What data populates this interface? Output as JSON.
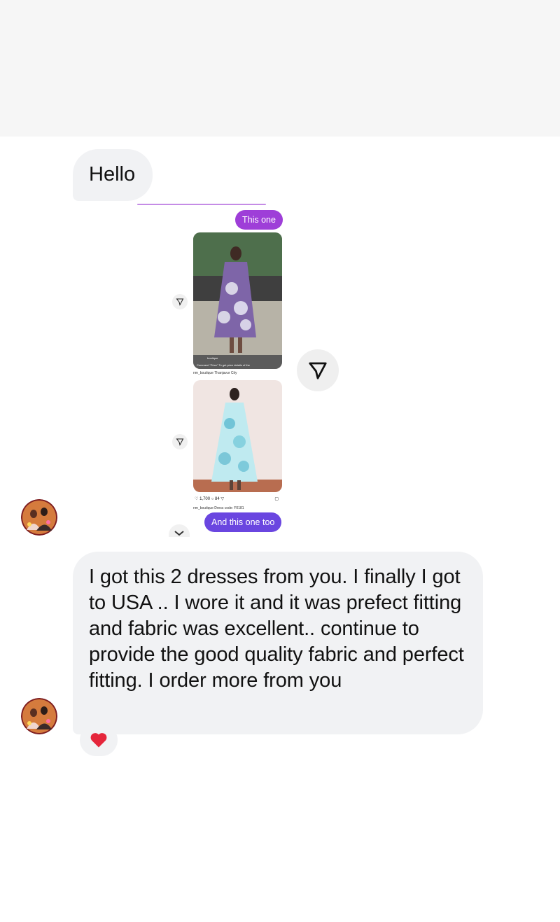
{
  "messages": {
    "greeting": "Hello",
    "reply_chip_1": "This one",
    "reply_chip_2": "And this one too",
    "body": "I got this 2 dresses from you. I finally I got to USA .. I wore it and it was prefect fitting and fabric was excellent.. continue to provide the good quality fabric and perfect fitting. I order more from  you"
  },
  "posts": {
    "first": {
      "brand": "boutique",
      "caption": "Comment \"Price\" To get price details of the"
    },
    "second": {
      "user": "nm_boutique",
      "location": "Thanjavur City",
      "likes": "1,700",
      "comments": "84",
      "caption": "nm_boutique Dress code: F0181"
    }
  },
  "colors": {
    "incoming_bubble": "#f1f2f4",
    "chip_purple": "#9e3ed8",
    "chip_indigo": "#6a46e0",
    "reaction": "#e5263b"
  },
  "icons": {
    "share": "paper-plane-icon",
    "reaction": "heart-icon",
    "scroll": "chevron-down-icon"
  }
}
